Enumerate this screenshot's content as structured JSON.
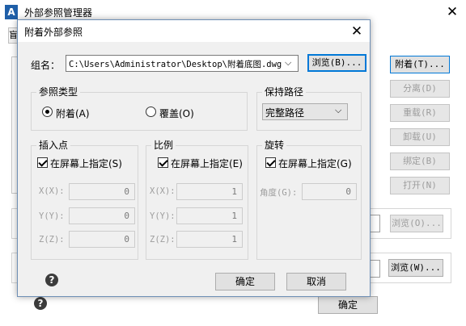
{
  "bg_window": {
    "title": "外部参照管理器",
    "app_icon_text": "A",
    "side_buttons": [
      "附着(T)...",
      "分离(D)",
      "重载(R)",
      "卸载(U)",
      "绑定(B)",
      "打开(N)"
    ],
    "browse1": "浏览(O)...",
    "browse2": "浏览(W)...",
    "ok": "确定"
  },
  "dialog": {
    "title": "附着外部参照",
    "name_label": "组名：",
    "name_value": "C:\\Users\\Administrator\\Desktop\\附着底图.dwg",
    "browse": "浏览(B)...",
    "ref_type": {
      "title": "参照类型",
      "attach": "附着(A)",
      "overlay": "覆盖(O)",
      "selected": "attach"
    },
    "path": {
      "title": "保持路径",
      "value": "完整路径"
    },
    "insert": {
      "title": "插入点",
      "specify": "在屏幕上指定(S)",
      "x_label": "X(X):",
      "y_label": "Y(Y):",
      "z_label": "Z(Z):",
      "x": "0",
      "y": "0",
      "z": "0"
    },
    "scale": {
      "title": "比例",
      "specify": "在屏幕上指定(E)",
      "x_label": "X(X):",
      "y_label": "Y(Y):",
      "z_label": "Z(Z):",
      "x": "1",
      "y": "1",
      "z": "1"
    },
    "rotation": {
      "title": "旋转",
      "specify": "在屏幕上指定(G)",
      "angle_label": "角度(G):",
      "angle": "0"
    },
    "ok": "确定",
    "cancel": "取消"
  }
}
